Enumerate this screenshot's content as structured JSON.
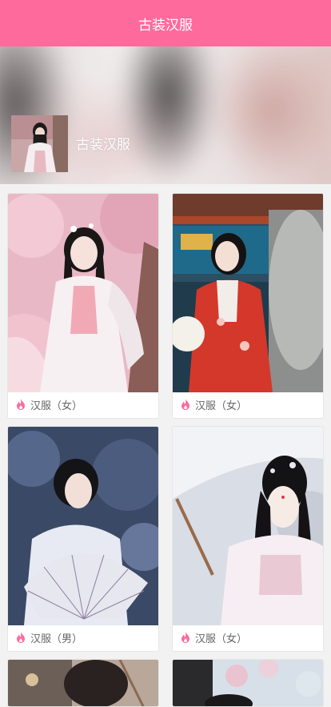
{
  "header": {
    "title": "古装汉服"
  },
  "banner": {
    "title": "古装汉服"
  },
  "cards": [
    {
      "label": "汉服（女）"
    },
    {
      "label": "汉服（女）"
    },
    {
      "label": "汉服（男）"
    },
    {
      "label": "汉服（女）"
    },
    {
      "label": ""
    },
    {
      "label": ""
    }
  ],
  "colors": {
    "accent": "#ff6a9c",
    "flame": "#ff6a9c"
  }
}
